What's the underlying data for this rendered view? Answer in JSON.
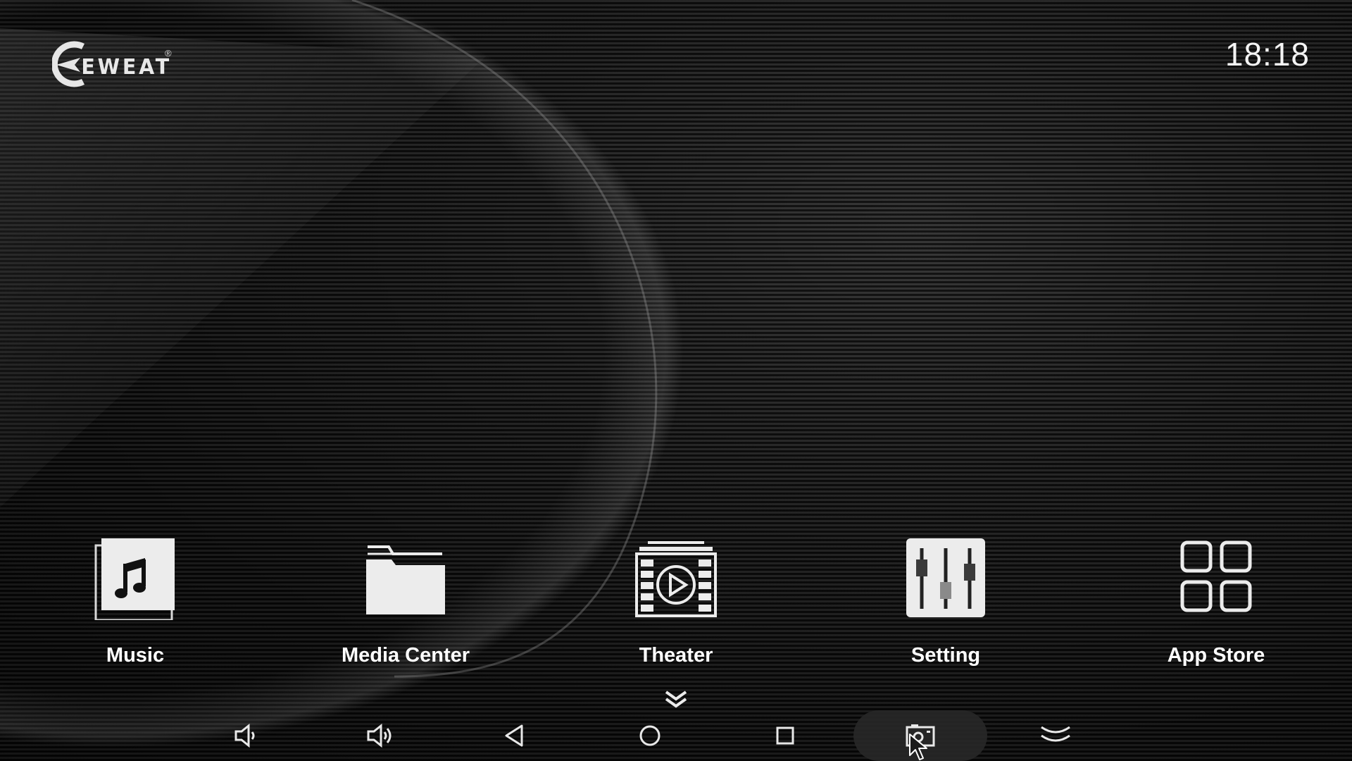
{
  "brand": {
    "logo_text": "EWEAT",
    "registered_mark": "®",
    "icon": "eweat-logo-icon"
  },
  "status": {
    "clock": "18:18"
  },
  "apps": [
    {
      "label": "Music",
      "icon": "music-note-icon"
    },
    {
      "label": "Media Center",
      "icon": "folder-icon"
    },
    {
      "label": "Theater",
      "icon": "film-play-icon"
    },
    {
      "label": "Setting",
      "icon": "sliders-icon"
    },
    {
      "label": "App Store",
      "icon": "app-grid-icon"
    }
  ],
  "more_indicator": {
    "icon": "double-chevron-down-icon"
  },
  "navbar": {
    "buttons": [
      {
        "name": "volume-down",
        "icon": "volume-down-icon"
      },
      {
        "name": "volume-up",
        "icon": "volume-up-icon"
      },
      {
        "name": "back",
        "icon": "back-triangle-icon"
      },
      {
        "name": "home",
        "icon": "home-circle-icon"
      },
      {
        "name": "recents",
        "icon": "recents-square-icon"
      },
      {
        "name": "screenshot",
        "icon": "screenshot-icon",
        "active": true
      },
      {
        "name": "hide-bar",
        "icon": "hide-bar-chevron-icon"
      }
    ]
  },
  "colors": {
    "text": "#ffffff",
    "icon_fill": "#ececec",
    "background": "#0b0b0b",
    "active_nav": "#282828"
  }
}
